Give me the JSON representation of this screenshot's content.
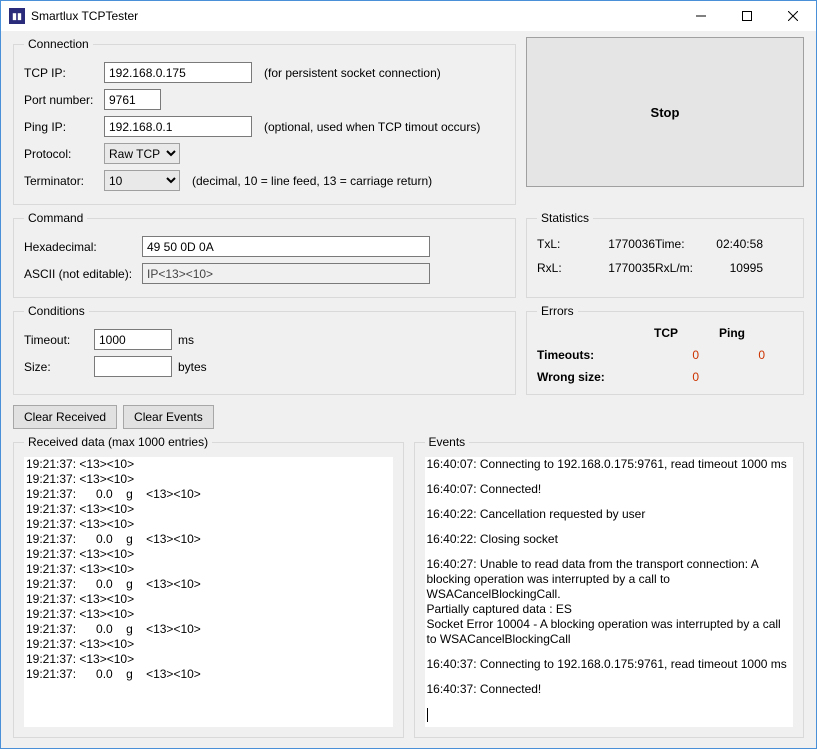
{
  "window": {
    "title": "Smartlux TCPTester"
  },
  "connection": {
    "legend": "Connection",
    "tcp_ip_label": "TCP IP:",
    "tcp_ip": "192.168.0.175",
    "tcp_ip_hint": "(for persistent socket connection)",
    "port_label": "Port number:",
    "port": "9761",
    "ping_ip_label": "Ping IP:",
    "ping_ip": "192.168.0.1",
    "ping_hint": "(optional, used when TCP timout occurs)",
    "protocol_label": "Protocol:",
    "protocol": "Raw TCP",
    "terminator_label": "Terminator:",
    "terminator": "10",
    "terminator_hint": "(decimal, 10 = line feed, 13 = carriage return)"
  },
  "stop": {
    "label": "Stop"
  },
  "command": {
    "legend": "Command",
    "hex_label": "Hexadecimal:",
    "hex": "49 50 0D 0A",
    "ascii_label": "ASCII (not editable):",
    "ascii": "IP<13><10>"
  },
  "statistics": {
    "legend": "Statistics",
    "txl_label": "TxL:",
    "txl": "1770036",
    "time_label": "Time:",
    "time": "02:40:58",
    "rxl_label": "RxL:",
    "rxl": "1770035",
    "rxlm_label": "RxL/m:",
    "rxlm": "10995"
  },
  "conditions": {
    "legend": "Conditions",
    "timeout_label": "Timeout:",
    "timeout": "1000",
    "timeout_unit": "ms",
    "size_label": "Size:",
    "size": "",
    "size_unit": "bytes"
  },
  "errors": {
    "legend": "Errors",
    "tcp_header": "TCP",
    "ping_header": "Ping",
    "timeouts_label": "Timeouts:",
    "timeouts_tcp": "0",
    "timeouts_ping": "0",
    "wrong_label": "Wrong size:",
    "wrong_tcp": "0"
  },
  "buttons": {
    "clear_received": "Clear Received",
    "clear_events": "Clear Events"
  },
  "received": {
    "legend": "Received data (max 1000 entries)",
    "lines": [
      "19:21:37: <13><10>",
      "19:21:37: <13><10>",
      "19:21:37:      0.0    g    <13><10>",
      "19:21:37: <13><10>",
      "19:21:37: <13><10>",
      "19:21:37:      0.0    g    <13><10>",
      "19:21:37: <13><10>",
      "19:21:37: <13><10>",
      "19:21:37:      0.0    g    <13><10>",
      "19:21:37: <13><10>",
      "19:21:37: <13><10>",
      "19:21:37:      0.0    g    <13><10>",
      "19:21:37: <13><10>",
      "19:21:37: <13><10>",
      "19:21:37:      0.0    g    <13><10>"
    ]
  },
  "events": {
    "legend": "Events",
    "entries": [
      "16:40:07: Connecting to 192.168.0.175:9761, read timeout 1000 ms",
      "16:40:07: Connected!",
      "16:40:22: Cancellation requested by user",
      "16:40:22: Closing socket",
      "16:40:27: Unable to read data from the transport connection: A blocking operation was interrupted by a call to WSACancelBlockingCall.\nPartially captured data : ES\nSocket Error 10004 - A blocking operation was interrupted by a call to WSACancelBlockingCall",
      "16:40:37: Connecting to 192.168.0.175:9761, read timeout 1000 ms",
      "16:40:37: Connected!"
    ]
  }
}
